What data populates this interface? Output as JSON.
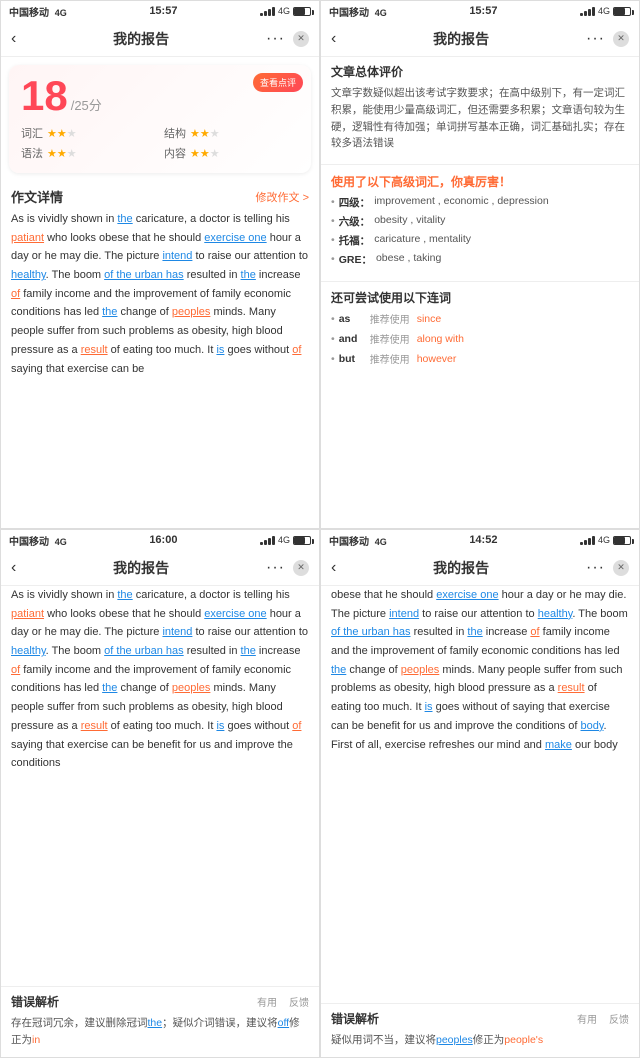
{
  "panel1": {
    "status": {
      "carrier": "中国移动",
      "network": "4G",
      "time": "15:57"
    },
    "nav": {
      "title": "我的报告",
      "back": "<",
      "dots": "···"
    },
    "score": {
      "view_btn": "查看点评",
      "number": "18",
      "total": "/25分",
      "items": [
        {
          "label": "词汇",
          "stars": 2,
          "max": 3
        },
        {
          "label": "结构",
          "stars": 2,
          "max": 3
        },
        {
          "label": "语法",
          "stars": 2,
          "max": 3
        },
        {
          "label": "内容",
          "stars": 2,
          "max": 3
        }
      ]
    },
    "essay_section": {
      "title": "作文详情",
      "action": "修改作文 >"
    },
    "essay_text": "As is vividly shown in the caricature, a doctor is telling his patiant who looks obese that he should exercise one hour a day or he may die. The picture intend to raise our attention to healthy. The boom of the urban has resulted in the increase of family income and the improvement of family economic conditions has led the change of peoples minds. Many people suffer from such problems as obesity, high blood pressure as a result of eating too much. It is goes without of saying that exercise can be"
  },
  "panel2": {
    "status": {
      "carrier": "中国移动",
      "network": "4G",
      "time": "15:57"
    },
    "nav": {
      "title": "我的报告",
      "back": "<",
      "dots": "···"
    },
    "eval": {
      "title": "文章总体评价",
      "text": "文章字数疑似超出该考试字数要求；在高中级别下，有一定词汇积累，能使用少量高级词汇，但还需要多积累；文章语句较为生硬，逻辑性有待加强；单词拼写基本正确，词汇基础扎实；存在较多语法错误"
    },
    "vocab": {
      "title": "使用了以下高级词汇，你真厉害！",
      "items": [
        {
          "level": "四级：",
          "words": "improvement , economic , depression"
        },
        {
          "level": "六级：",
          "words": "obesity , vitality"
        },
        {
          "level": "托福：",
          "words": "caricature , mentality"
        },
        {
          "level": "GRE：",
          "words": "obese , taking"
        }
      ]
    },
    "connectives": {
      "title": "还可尝试使用以下连词",
      "items": [
        {
          "word": "as",
          "suggest": "推荐使用",
          "alt": "since"
        },
        {
          "word": "and",
          "suggest": "推荐使用",
          "alt": "along with"
        },
        {
          "word": "but",
          "suggest": "推荐使用",
          "alt": "however"
        }
      ]
    }
  },
  "panel3": {
    "status": {
      "carrier": "中国移动",
      "network": "4G",
      "time": "16:00"
    },
    "nav": {
      "title": "我的报告",
      "back": "<",
      "dots": "···"
    },
    "essay_text": "As is vividly shown in the caricature, a doctor is telling his patiant who looks obese that he should exercise one hour a day or he may die. The picture intend to raise our attention to healthy. The boom of the urban has resulted in the increase of family income and the improvement of family economic conditions has led the change of peoples minds. Many people suffer from such problems as obesity, high blood pressure as a result of eating too much. It is goes without of saying that exercise can be benefit for us and improve the conditions",
    "error": {
      "title": "错误解析",
      "useful": "有用",
      "feedback": "反馈",
      "text": "存在冠词冗余，建议删除冠词the；疑似介词错误，建议将off修正为in"
    }
  },
  "panel4": {
    "status": {
      "carrier": "中国移动",
      "network": "4G",
      "time": "14:52"
    },
    "nav": {
      "title": "我的报告",
      "back": "<",
      "dots": "···"
    },
    "essay_text": "obese that he should exercise one hour a day or he may die. The picture intend to raise our attention to healthy. The boom of the urban has resulted in the increase of family income and the improvement of family economic conditions has led the change of peoples minds. Many people suffer from such problems as obesity, high blood pressure as a result of eating too much. It is goes without of saying that exercise can be benefit for us and improve the conditions of body. First of all, exercise refreshes our mind and make our body",
    "error": {
      "title": "错误解析",
      "useful": "有用",
      "feedback": "反馈",
      "text": "疑似用词不当，建议将peoples修正为people's"
    }
  }
}
